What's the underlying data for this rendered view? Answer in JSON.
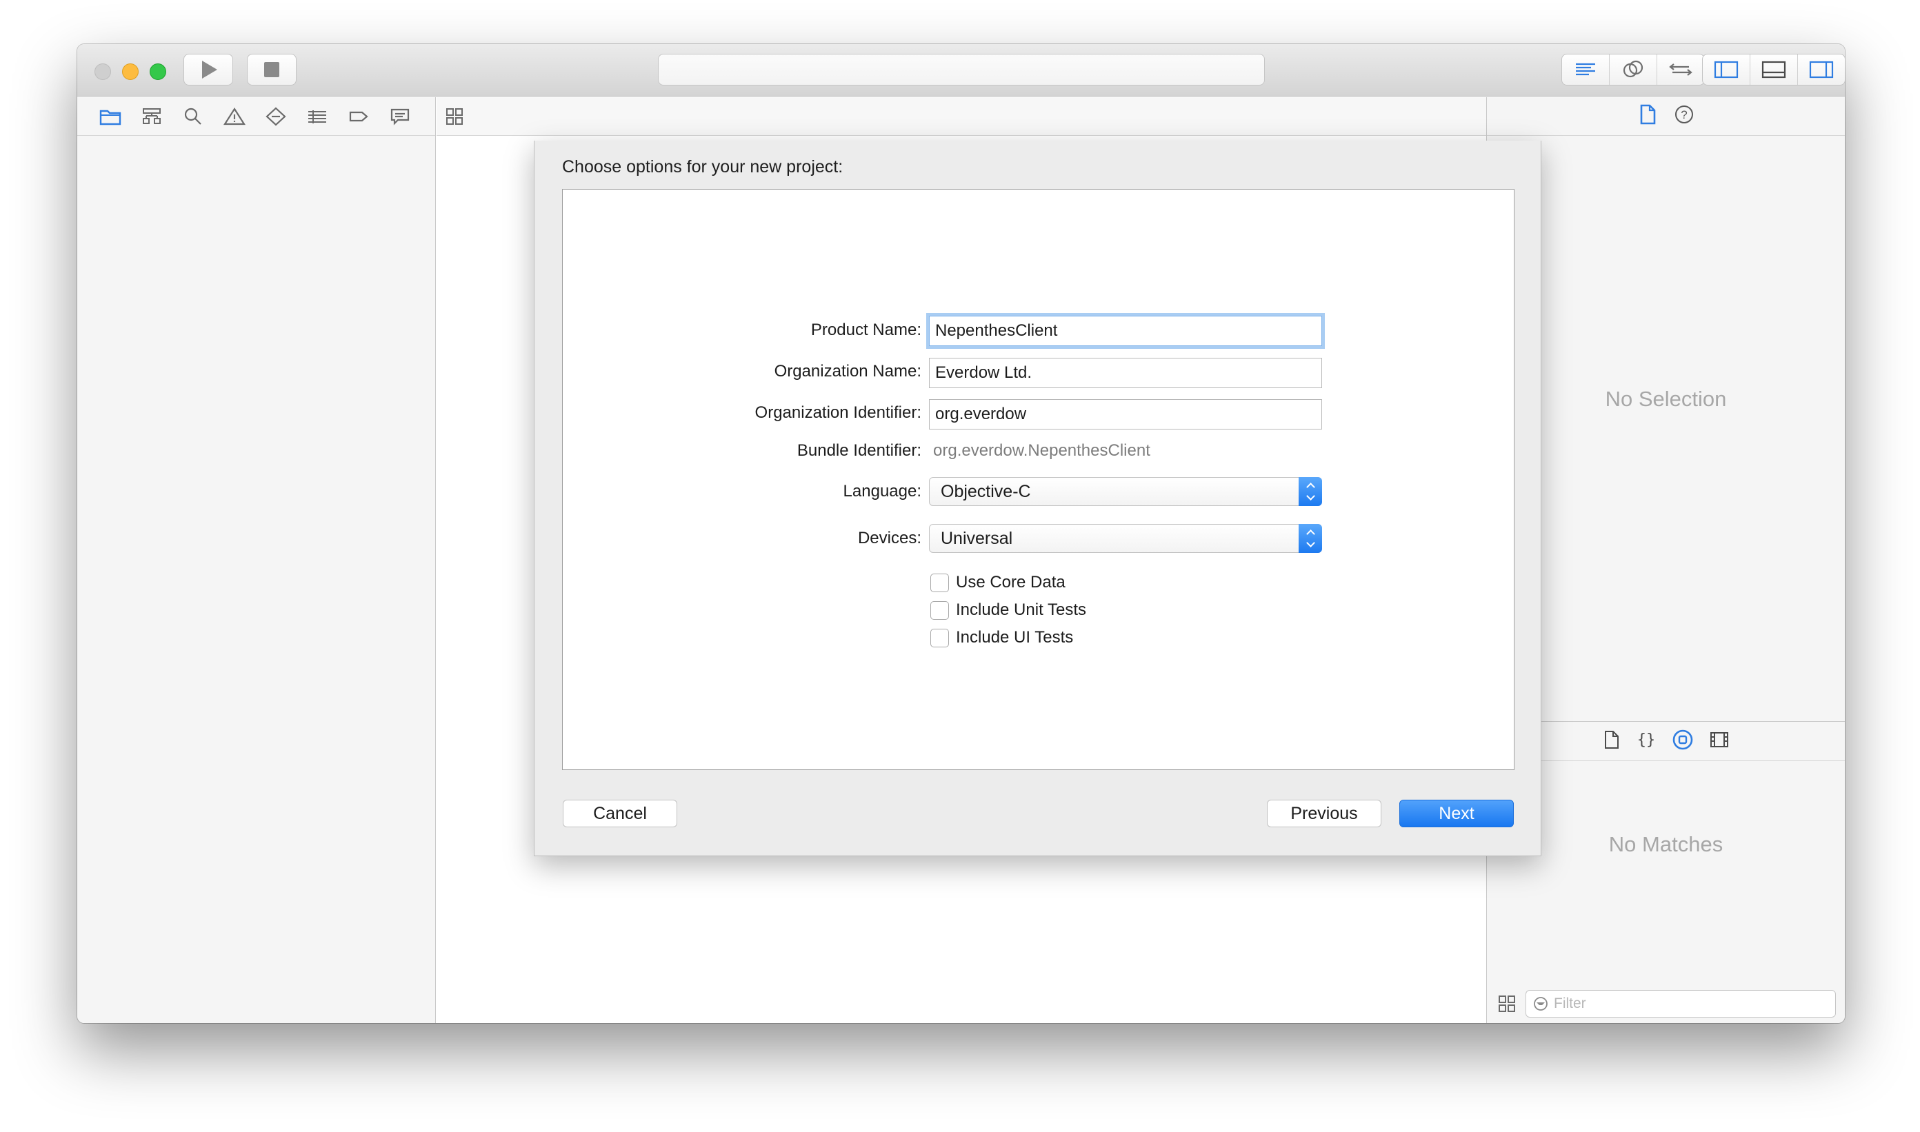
{
  "colors": {
    "accent": "#1877f0",
    "traffic_close": "#cfcfcf",
    "traffic_minimize": "#fdbc40",
    "traffic_zoom": "#34c84a",
    "placeholder_text": "#a7a7a7"
  },
  "toolbar": {
    "icons": [
      "play-icon",
      "stop-icon",
      "standard-editor-icon",
      "assistant-editor-icon",
      "version-editor-icon",
      "navigator-panel-icon",
      "debug-area-icon",
      "utilities-panel-icon"
    ]
  },
  "navigator": {
    "icons": [
      "folder-icon",
      "hierarchy-icon",
      "search-icon",
      "warning-icon",
      "test-diamond-icon",
      "debug-list-icon",
      "breakpoint-icon",
      "report-icon"
    ]
  },
  "dialog": {
    "title": "Choose options for your new project:",
    "fields": {
      "product_name": {
        "label": "Product Name:",
        "value": "NepenthesClient"
      },
      "organization_name": {
        "label": "Organization Name:",
        "value": "Everdow Ltd."
      },
      "organization_identifier": {
        "label": "Organization Identifier:",
        "value": "org.everdow"
      },
      "bundle_identifier": {
        "label": "Bundle Identifier:",
        "value": "org.everdow.NepenthesClient"
      },
      "language": {
        "label": "Language:",
        "value": "Objective-C"
      },
      "devices": {
        "label": "Devices:",
        "value": "Universal"
      }
    },
    "checkboxes": [
      {
        "label": "Use Core Data",
        "checked": false
      },
      {
        "label": "Include Unit Tests",
        "checked": false
      },
      {
        "label": "Include UI Tests",
        "checked": false
      }
    ],
    "buttons": {
      "cancel": "Cancel",
      "previous": "Previous",
      "next": "Next"
    }
  },
  "inspector": {
    "no_selection": "No Selection",
    "no_matches": "No Matches",
    "filter_placeholder": "Filter"
  }
}
